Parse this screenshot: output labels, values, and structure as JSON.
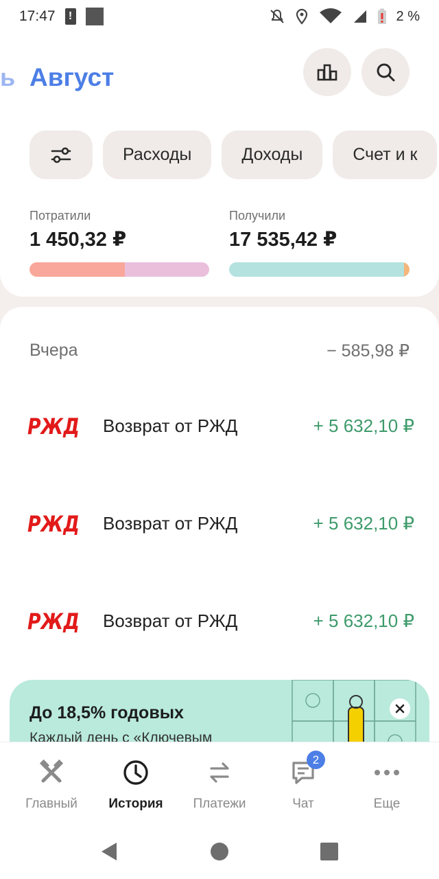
{
  "status_bar": {
    "time": "17:47",
    "battery_percent": "2 %"
  },
  "header": {
    "prev_month_fragment": "ь",
    "current_month": "Август"
  },
  "filters": {
    "chips": [
      "Расходы",
      "Доходы",
      "Счет и к"
    ]
  },
  "summary": {
    "spent_label": "Потратили",
    "spent_value": "1 450,32 ₽",
    "received_label": "Получили",
    "received_value": "17 535,42 ₽",
    "spent_bar": [
      0.53,
      0.47
    ],
    "received_bar": [
      0.97,
      0.03
    ]
  },
  "history": {
    "day_label": "Вчера",
    "day_total": "− 585,98 ₽",
    "transactions": [
      {
        "merchant": "Возврат от РЖД",
        "amount": "+ 5 632,10 ₽",
        "logo_text": "РЖД"
      },
      {
        "merchant": "Возврат от РЖД",
        "amount": "+ 5 632,10 ₽",
        "logo_text": "РЖД"
      },
      {
        "merchant": "Возврат от РЖД",
        "amount": "+ 5 632,10 ₽",
        "logo_text": "РЖД"
      }
    ]
  },
  "promo": {
    "title": "До 18,5% годовых",
    "subtitle": "Каждый день с «Ключевым"
  },
  "bottom_nav": {
    "items": [
      {
        "label": "Главный",
        "icon": "home-tools-icon"
      },
      {
        "label": "История",
        "icon": "clock-icon"
      },
      {
        "label": "Платежи",
        "icon": "transfer-arrows-icon"
      },
      {
        "label": "Чат",
        "icon": "chat-icon"
      },
      {
        "label": "Еще",
        "icon": "more-dots-icon"
      }
    ],
    "active_index": 1,
    "chat_badge": "2"
  },
  "colors": {
    "accent_blue": "#4c7ee6",
    "positive_green": "#3d9a6a",
    "rzd_red": "#e21a1a",
    "spent_bar_1": "#f9a79a",
    "spent_bar_2": "#eabfdc",
    "received_bar_1": "#b3e2df",
    "received_bar_2": "#f5b57a"
  }
}
